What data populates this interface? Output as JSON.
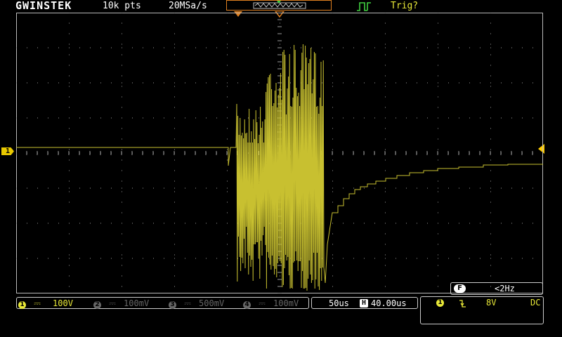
{
  "header": {
    "brand": "GWINSTEK",
    "record_length": "10k pts",
    "sample_rate": "20MSa/s",
    "trigger_status": "Trig?"
  },
  "channels": [
    {
      "num": "1",
      "coupling": "DC",
      "scale": "100V",
      "active": true,
      "color": "#e8e838"
    },
    {
      "num": "2",
      "coupling": "DC",
      "scale": "100mV",
      "active": false,
      "color": "#666666"
    },
    {
      "num": "3",
      "coupling": "DC",
      "scale": "500mV",
      "active": false,
      "color": "#666666"
    },
    {
      "num": "4",
      "coupling": "DC",
      "scale": "100mV",
      "active": false,
      "color": "#666666"
    }
  ],
  "timebase": {
    "scale": "50us",
    "position_icon": "H",
    "position": "40.00us"
  },
  "frequency": {
    "icon": "F",
    "value": "<2Hz"
  },
  "trigger": {
    "source": "1",
    "slope_icon": "falling-edge-icon",
    "level": "8V",
    "coupling": "DC"
  },
  "ch1_marker": "1",
  "colors": {
    "trace": "#c8c030",
    "grid": "#9a9a9a",
    "accent_orange": "#e08020",
    "trigger_marker": "#ffcc00",
    "trigger_green": "#40d040"
  }
}
